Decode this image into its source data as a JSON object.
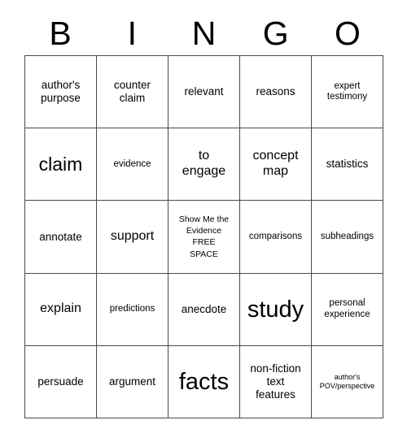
{
  "card": {
    "title_letters": [
      "B",
      "I",
      "N",
      "G",
      "O"
    ],
    "colors": {
      "background": "#ffffff",
      "text": "#000000",
      "grid_line": "#4a4a4a"
    },
    "rows": [
      [
        {
          "text": "author's\npurpose",
          "size": "fs-md"
        },
        {
          "text": "counter\nclaim",
          "size": "fs-md"
        },
        {
          "text": "relevant",
          "size": "fs-md"
        },
        {
          "text": "reasons",
          "size": "fs-md"
        },
        {
          "text": "expert\ntestimony",
          "size": "fs-sm"
        }
      ],
      [
        {
          "text": "claim",
          "size": "fs-xl"
        },
        {
          "text": "evidence",
          "size": "fs-sm"
        },
        {
          "text": "to\nengage",
          "size": "fs-lg"
        },
        {
          "text": "concept\nmap",
          "size": "fs-lg"
        },
        {
          "text": "statistics",
          "size": "fs-md"
        }
      ],
      [
        {
          "text": "annotate",
          "size": "fs-md"
        },
        {
          "text": "support",
          "size": "fs-lg"
        },
        {
          "text": "Show Me the\nEvidence\nFREE\nSPACE",
          "size": "fs-free"
        },
        {
          "text": "comparisons",
          "size": "fs-sm"
        },
        {
          "text": "subheadings",
          "size": "fs-sm"
        }
      ],
      [
        {
          "text": "explain",
          "size": "fs-lg"
        },
        {
          "text": "predictions",
          "size": "fs-sm"
        },
        {
          "text": "anecdote",
          "size": "fs-md"
        },
        {
          "text": "study",
          "size": "fs-xxl"
        },
        {
          "text": "personal\nexperience",
          "size": "fs-sm"
        }
      ],
      [
        {
          "text": "persuade",
          "size": "fs-md"
        },
        {
          "text": "argument",
          "size": "fs-md"
        },
        {
          "text": "facts",
          "size": "fs-xxl"
        },
        {
          "text": "non-fiction\ntext\nfeatures",
          "size": "fs-md"
        },
        {
          "text": "author's\nPOV/perspective",
          "size": "fs-xs"
        }
      ]
    ]
  }
}
